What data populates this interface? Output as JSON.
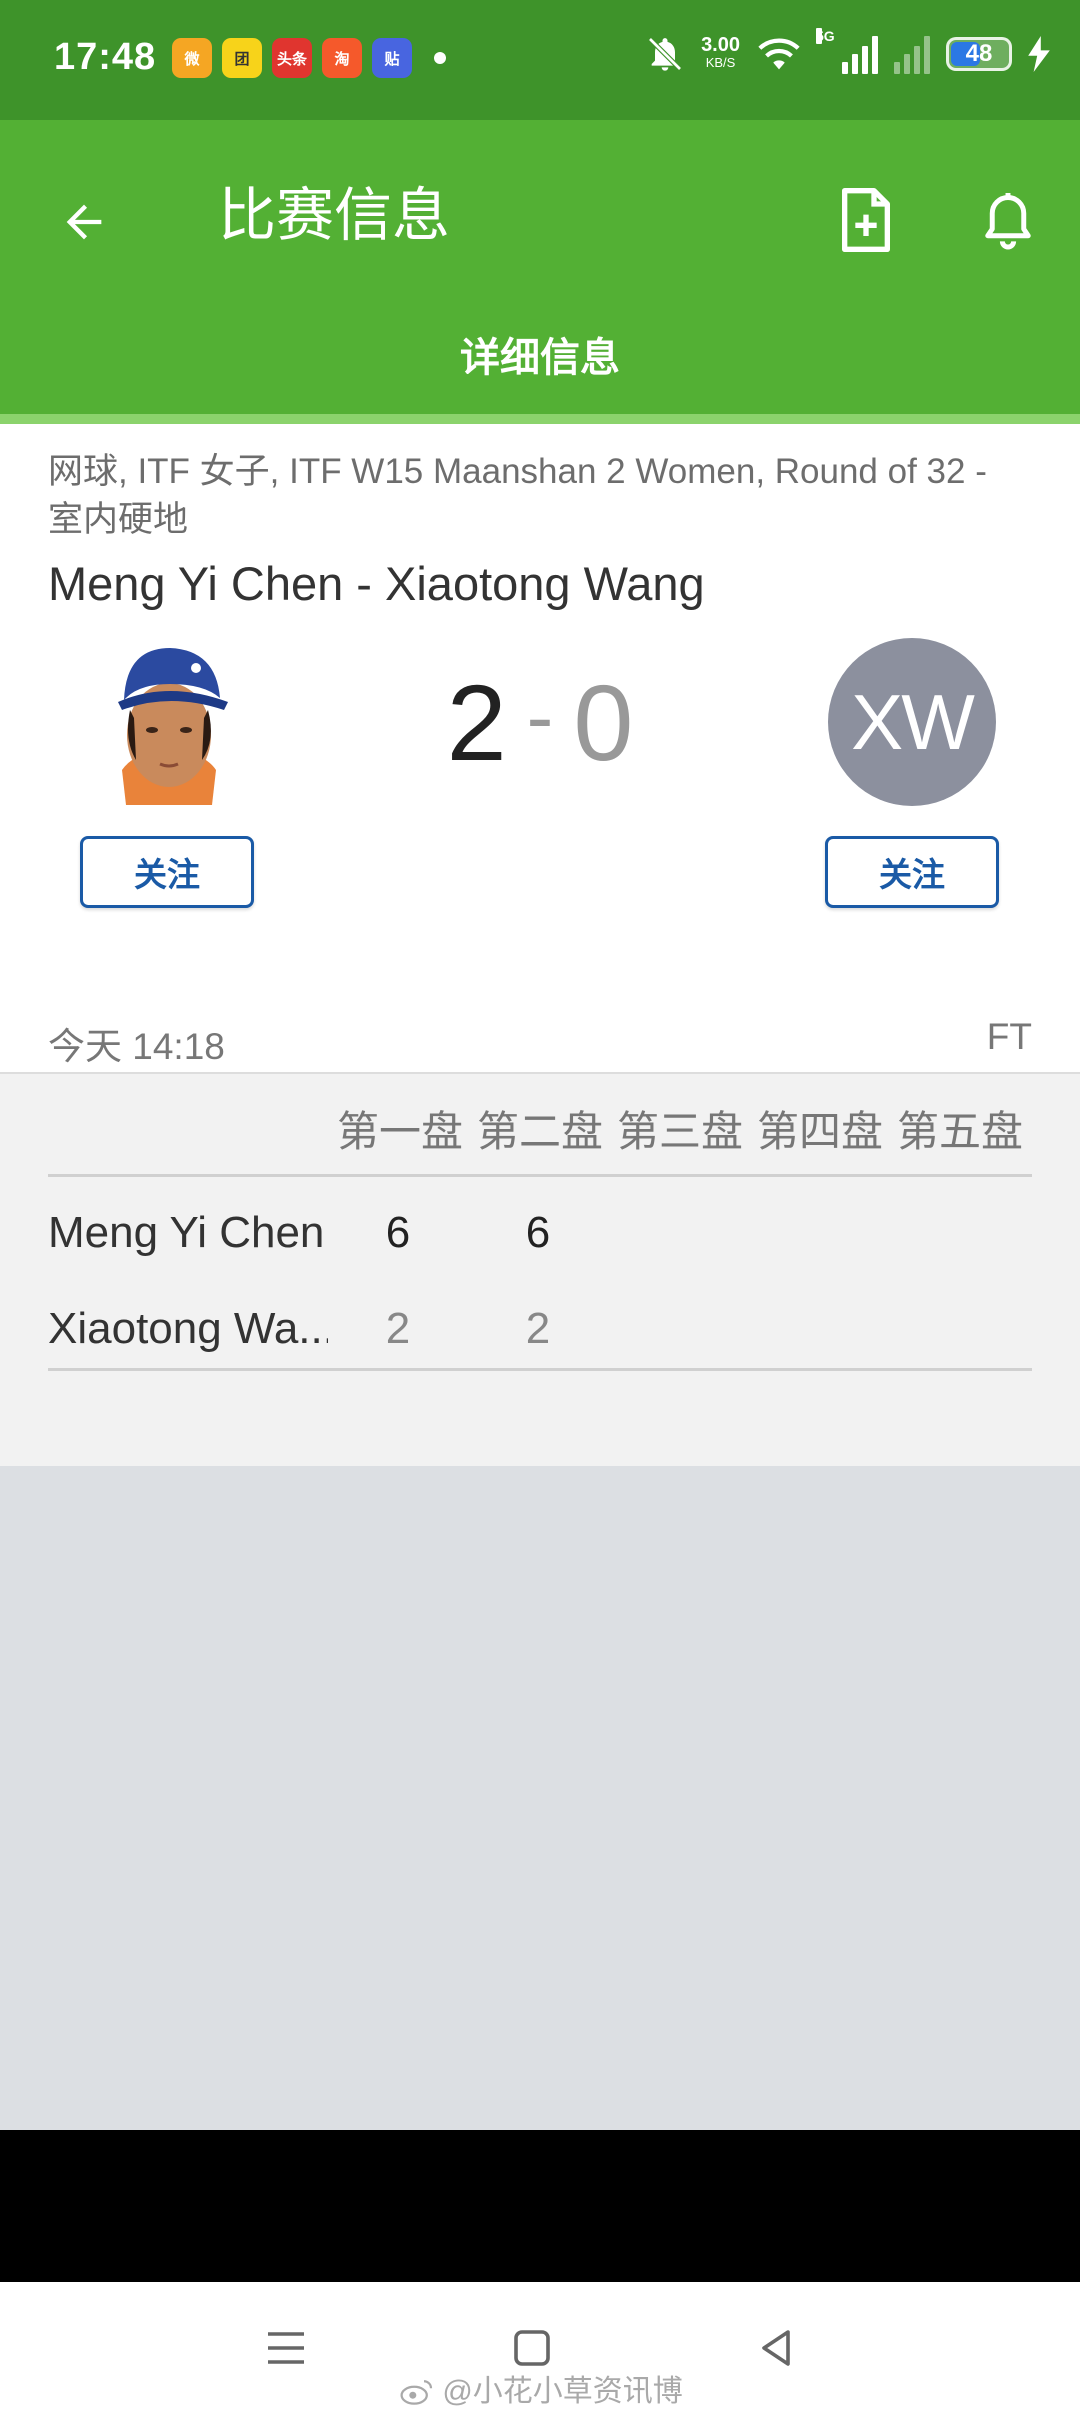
{
  "status_bar": {
    "time": "17:48",
    "notification_icons": [
      {
        "name": "weibo-app-icon",
        "label": "微",
        "color": "#f5a623"
      },
      {
        "name": "meituan-app-icon",
        "label": "团",
        "color": "#f7d31a"
      },
      {
        "name": "toutiao-app-icon",
        "label": "头条",
        "color": "#e0352f"
      },
      {
        "name": "taobao-app-icon",
        "label": "淘",
        "color": "#f5592b"
      },
      {
        "name": "tieba-app-icon",
        "label": "贴",
        "color": "#4865e0"
      }
    ],
    "net_speed": "3.00",
    "net_speed_unit": "KB/S",
    "network_type": "5G",
    "battery": "48"
  },
  "app_bar": {
    "title": "比赛信息",
    "tab_label": "详细信息"
  },
  "match": {
    "breadcrumb": "网球, ITF 女子, ITF W15 Maanshan 2 Women, Round of 32 - 室内硬地",
    "title": "Meng Yi Chen - Xiaotong Wang",
    "home_score": "2",
    "separator": "-",
    "away_score": "0",
    "away_initials": "XW",
    "follow_label": "关注",
    "time": "今天 14:18",
    "status": "FT"
  },
  "score_table": {
    "set_headers": [
      "第一盘",
      "第二盘",
      "第三盘",
      "第四盘",
      "第五盘"
    ],
    "rows": [
      {
        "name": "Meng Yi Chen",
        "sets": [
          "6",
          "6"
        ]
      },
      {
        "name": "Xiaotong Wa...",
        "sets": [
          "2",
          "2"
        ]
      }
    ]
  },
  "watermark": "@小花小草资讯博"
}
